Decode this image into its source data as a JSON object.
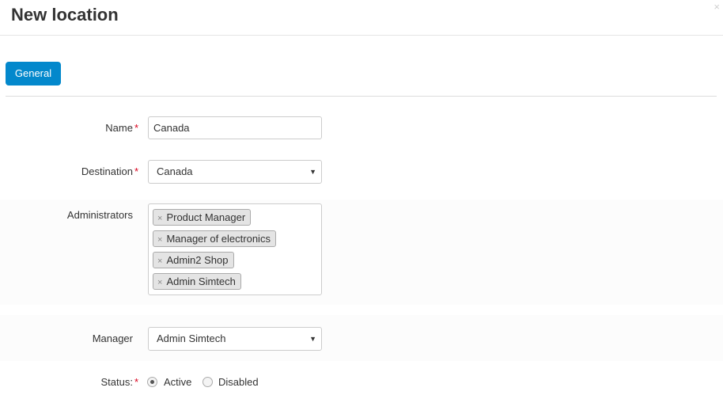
{
  "dialog": {
    "title": "New location",
    "close_icon": "close-icon",
    "close_glyph": "×"
  },
  "tabs": [
    {
      "label": "General",
      "active": true
    }
  ],
  "colors": {
    "accent": "#0388cc",
    "required": "#d9001c"
  },
  "form": {
    "name": {
      "label": "Name",
      "required_mark": "*",
      "value": "Canada"
    },
    "destination": {
      "label": "Destination",
      "required_mark": "*",
      "value": "Canada"
    },
    "administrators": {
      "label": "Administrators",
      "remove_glyph": "×",
      "tags": [
        "Product Manager",
        "Manager of electronics",
        "Admin2 Shop",
        "Admin Simtech"
      ]
    },
    "manager": {
      "label": "Manager",
      "value": "Admin Simtech"
    },
    "status": {
      "label": "Status:",
      "required_mark": "*",
      "options": [
        {
          "label": "Active",
          "selected": true
        },
        {
          "label": "Disabled",
          "selected": false
        }
      ]
    }
  }
}
